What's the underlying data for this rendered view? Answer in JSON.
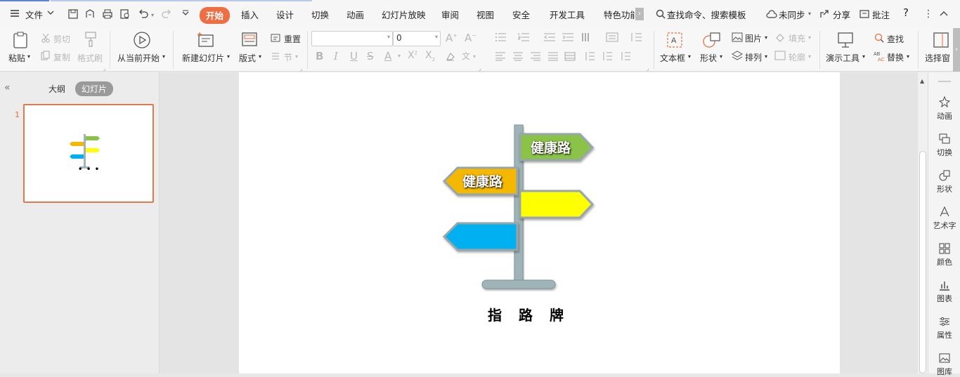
{
  "menu": {
    "file_label": "文件",
    "tabs": [
      "开始",
      "插入",
      "设计",
      "切换",
      "动画",
      "幻灯片放映",
      "审阅",
      "视图",
      "安全",
      "开发工具",
      "特色功能"
    ],
    "active_tab": "开始",
    "search_text": "查找命令、搜索模板",
    "sync_label": "未同步",
    "share_label": "分享",
    "comment_label": "批注",
    "help_label": "?"
  },
  "ribbon": {
    "paste": "粘贴",
    "cut": "剪切",
    "copy": "复制",
    "format_painter": "格式刷",
    "from_current": "从当前开始",
    "new_slide": "新建幻灯片",
    "layout": "版式",
    "reset": "重置",
    "section": "节",
    "font_name": "",
    "font_size": "0",
    "textbox": "文本框",
    "shape": "形状",
    "picture": "图片",
    "fill": "填充",
    "arrange": "排列",
    "outline": "轮廓",
    "present_tools": "演示工具",
    "find": "查找",
    "replace": "替换",
    "select_pane": "选择窗"
  },
  "left_panel": {
    "outline_tab": "大纲",
    "slides_tab": "幻灯片",
    "slide_number": "1",
    "thumb_caption": "• • •"
  },
  "slide": {
    "sign_top_right": "健康路",
    "sign_left": "健康路",
    "sign_right_yellow": "",
    "sign_left_blue": "",
    "caption": "指　路　牌",
    "colors": {
      "green": "#8bc34a",
      "orange": "#f5b800",
      "yellow": "#ffff00",
      "blue": "#00b0f0",
      "pole": "#9fb4b8"
    }
  },
  "right_panel": {
    "items": [
      "动画",
      "切换",
      "形状",
      "艺术字",
      "颜色",
      "图表",
      "属性",
      "图库"
    ]
  }
}
